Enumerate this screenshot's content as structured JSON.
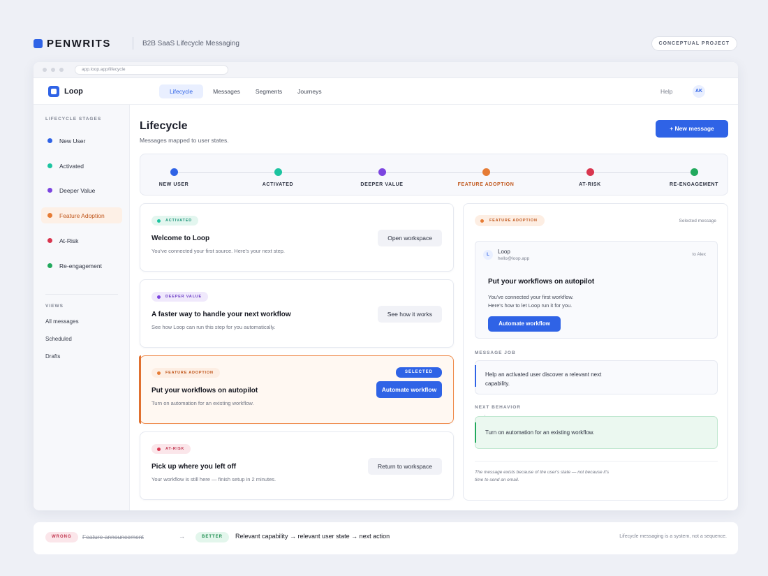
{
  "brand": {
    "name": "PENWRITS",
    "subtitle": "B2B SaaS Lifecycle Messaging",
    "badge": "CONCEPTUAL PROJECT"
  },
  "browser": {
    "url": "app.loop.app/lifecycle"
  },
  "app": {
    "name": "Loop",
    "tabs": [
      "Lifecycle",
      "Messages",
      "Segments",
      "Journeys"
    ],
    "active_tab": "Lifecycle",
    "help": "Help",
    "avatar_initials": "AK"
  },
  "sidebar": {
    "stages_heading": "LIFECYCLE STAGES",
    "stages": [
      {
        "label": "New User",
        "color": "#2f63e6"
      },
      {
        "label": "Activated",
        "color": "#1cc4a0"
      },
      {
        "label": "Deeper Value",
        "color": "#7c45e0"
      },
      {
        "label": "Feature Adoption",
        "color": "#e67c35",
        "active": true
      },
      {
        "label": "At-Risk",
        "color": "#d9364f"
      },
      {
        "label": "Re-engagement",
        "color": "#22a95d"
      }
    ],
    "views_heading": "VIEWS",
    "views": [
      "All messages",
      "Scheduled",
      "Drafts"
    ]
  },
  "main": {
    "title": "Lifecycle",
    "subtitle": "Messages mapped to user states.",
    "new_message": "+ New message",
    "stages": [
      {
        "label": "NEW USER",
        "color": "#2f63e6"
      },
      {
        "label": "ACTIVATED",
        "color": "#1cc4a0"
      },
      {
        "label": "DEEPER VALUE",
        "color": "#7c45e0"
      },
      {
        "label": "FEATURE ADOPTION",
        "color": "#e67c35",
        "current": true
      },
      {
        "label": "AT-RISK",
        "color": "#d9364f"
      },
      {
        "label": "RE-ENGAGEMENT",
        "color": "#22a95d"
      }
    ],
    "cards": [
      {
        "tag": "ACTIVATED",
        "tag_bg": "#e3f6ef",
        "tag_color": "#1a9478",
        "dot": "#1cc4a0",
        "title": "Welcome to Loop",
        "desc": "You've connected your first source. Here's your next step.",
        "action": "Open workspace"
      },
      {
        "tag": "DEEPER VALUE",
        "tag_bg": "#f0e9fc",
        "tag_color": "#6a3bc4",
        "dot": "#7c45e0",
        "title": "A faster way to handle your next workflow",
        "desc": "See how Loop can run this step for you automatically.",
        "action": "See how it works"
      },
      {
        "tag": "FEATURE ADOPTION",
        "tag_bg": "#fdeee3",
        "tag_color": "#c0561b",
        "dot": "#e67c35",
        "title": "Put your workflows on autopilot",
        "desc": "Turn on automation for an existing workflow.",
        "action": "Automate workflow",
        "selected_label": "SELECTED"
      },
      {
        "tag": "AT-RISK",
        "tag_bg": "#fbe6ea",
        "tag_color": "#c0344d",
        "dot": "#d9364f",
        "title": "Pick up where you left off",
        "desc": "Your workflow is still here — finish setup in 2 minutes.",
        "action": "Return to workspace"
      }
    ]
  },
  "panel": {
    "tag": "FEATURE ADOPTION",
    "meta": "Selected message",
    "email": {
      "avatar": "L",
      "from": "Loop",
      "address": "hello@loop.app",
      "to": "to Alex",
      "subject": "Put your workflows on autopilot",
      "body_line1": "You've connected your first workflow.",
      "body_line2": "Here's how to let Loop run it for you.",
      "cta": "Automate workflow"
    },
    "job_heading": "MESSAGE JOB",
    "job_text": "Help an activated user discover a relevant next capability.",
    "behavior_heading": "NEXT BEHAVIOR",
    "behavior_text": "Turn on automation for an existing workflow.",
    "note": "The message exists because of the user's state — not because it's time to send an email."
  },
  "bottom": {
    "wrong_label": "WRONG",
    "wrong_text": "Feature announcement",
    "arrow": "→",
    "better_label": "BETTER",
    "better_text": "Relevant capability → relevant user state → next action",
    "note": "Lifecycle messaging is a system, not a sequence."
  }
}
